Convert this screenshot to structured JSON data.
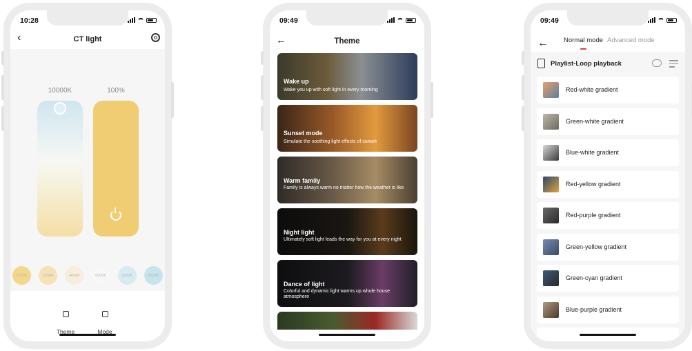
{
  "phone1": {
    "time": "10:28",
    "title": "CT light",
    "ct_value": "10000K",
    "brightness_value": "100%",
    "presets": [
      "2700K",
      "3500K",
      "4000K",
      "5000K",
      "6000K",
      "6500K"
    ],
    "preset_colors": [
      "#f3d78a",
      "#f5e3b5",
      "#f8eedb",
      "#f7f7f7",
      "#d7ebf2",
      "#c7e3ec"
    ],
    "nav": [
      {
        "label": "Theme",
        "icon": "theme-icon"
      },
      {
        "label": "Mode",
        "icon": "mode-icon"
      }
    ]
  },
  "phone2": {
    "time": "09:49",
    "title": "Theme",
    "themes": [
      {
        "name": "Wake up",
        "desc": "Wake you up with soft light in every morning",
        "bg": "linear-gradient(90deg,#3b3a2a,#6b5a3a 35%,#8b8f92 60%,#2c3c5c)"
      },
      {
        "name": "Sunset mode",
        "desc": "Simulate the soothing light effects of sunset",
        "bg": "linear-gradient(90deg,#3a2518,#9a5a28 40%,#e39a3e 70%,#7a4420)"
      },
      {
        "name": "Warm family",
        "desc": "Family is always warm no matter how the weather is like",
        "bg": "linear-gradient(90deg,#2e2a26,#6a5a48 40%,#a68c64 70%,#4c3f32)"
      },
      {
        "name": "Night light",
        "desc": "Ultimately soft light leads the way for you at every night",
        "bg": "linear-gradient(90deg,#0c0c0c,#1a1612 50%,#5a3c1c 75%,#1a140c)"
      },
      {
        "name": "Dance of light",
        "desc": "Colorful and dynamic light warms up whole house atmosphere",
        "bg": "linear-gradient(90deg,#0e0e10,#1c1a1e 50%,#6a3c66 75%,#202028)"
      },
      {
        "name": "",
        "desc": "",
        "bg": "linear-gradient(90deg,#2a3a20,#4a5a30 40%,#9a2a24 70%,#d8d8d8)"
      }
    ]
  },
  "phone3": {
    "time": "09:49",
    "mode_active": "Normal mode",
    "mode_inactive": "Advanced mode",
    "playlist_title": "Playlist-Loop playback",
    "items": [
      {
        "name": "Red-white gradient",
        "thumb": "linear-gradient(135deg,#e8a06a,#5a7fa0)"
      },
      {
        "name": "Green-white gradient",
        "thumb": "linear-gradient(135deg,#bfb6a8,#6e6a62)"
      },
      {
        "name": "Blue-white gradient",
        "thumb": "linear-gradient(135deg,#d8d8d8,#3a3a3a)"
      },
      {
        "name": "Red-yellow gradient",
        "thumb": "linear-gradient(135deg,#2c4a6a,#e0a040)"
      },
      {
        "name": "Red-purple gradient",
        "thumb": "linear-gradient(135deg,#6a6a6a,#2a2a2a)"
      },
      {
        "name": "Green-yellow gradient",
        "thumb": "linear-gradient(135deg,#7a8ab0,#3a4a6a)"
      },
      {
        "name": "Green-cyan gradient",
        "thumb": "linear-gradient(135deg,#3a5a7a,#2a2a2a)"
      },
      {
        "name": "Blue-purple gradient",
        "thumb": "linear-gradient(135deg,#b09a80,#4a3a2a)"
      }
    ]
  }
}
